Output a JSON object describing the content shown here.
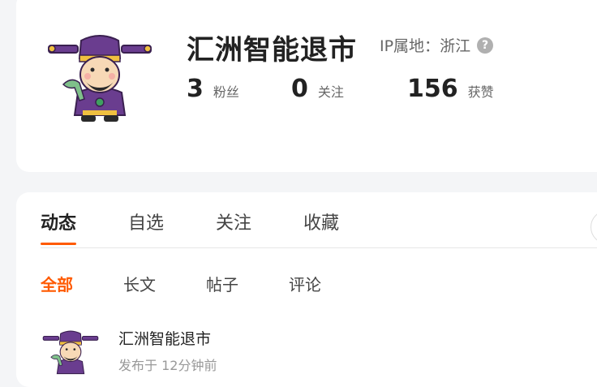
{
  "profile": {
    "name": "汇洲智能退市",
    "ip_label": "IP属地：",
    "ip_location": "浙江",
    "help_icon": "?",
    "stats": [
      {
        "value": "3",
        "label": "粉丝"
      },
      {
        "value": "0",
        "label": "关注"
      },
      {
        "value": "156",
        "label": "获赞"
      }
    ]
  },
  "tabs": [
    "动态",
    "自选",
    "关注",
    "收藏"
  ],
  "subtabs": [
    "全部",
    "长文",
    "帖子",
    "评论"
  ],
  "post": {
    "author": "汇洲智能退市",
    "time": "发布于 12分钟前"
  },
  "colors": {
    "accent": "#ff5a00",
    "avatar_purple": "#6a3d8f"
  }
}
